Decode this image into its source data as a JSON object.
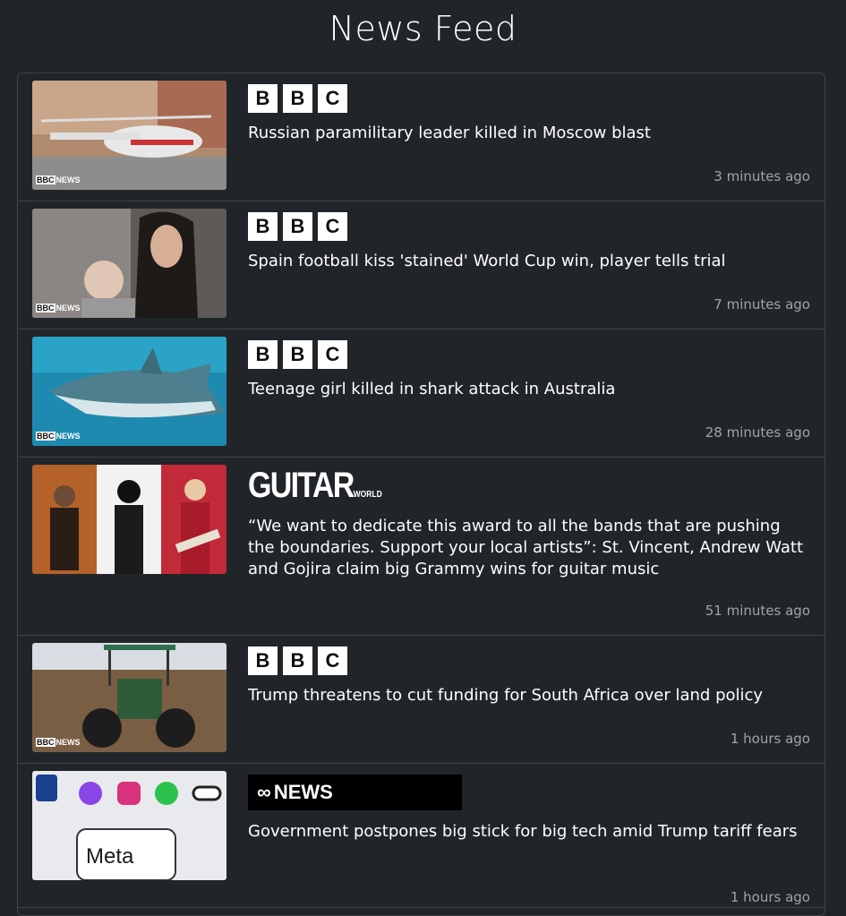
{
  "page": {
    "title": "News Feed"
  },
  "bbc_letters": [
    "B",
    "B",
    "C"
  ],
  "guitar_logo": {
    "main": "GUITAR",
    "sub": "WORLD"
  },
  "abc_logo": {
    "text": "NEWS"
  },
  "watermark": {
    "brand": "BBC",
    "label": "NEWS"
  },
  "items": [
    {
      "source": "bbc",
      "headline": "Russian paramilitary leader killed in Moscow blast",
      "time": "3 minutes ago",
      "image": "helicopter-photo"
    },
    {
      "source": "bbc",
      "headline": "Spain football kiss 'stained' World Cup win, player tells trial",
      "time": "7 minutes ago",
      "image": "footballer-photo"
    },
    {
      "source": "bbc",
      "headline": "Teenage girl killed in shark attack in Australia",
      "time": "28 minutes ago",
      "image": "shark-photo"
    },
    {
      "source": "guitarworld",
      "headline": "“We want to dedicate this award to all the bands that are pushing the boundaries. Support your local artists”: St. Vincent, Andrew Watt and Gojira claim big Grammy wins for guitar music",
      "time": "51 minutes ago",
      "image": "guitarists-photo"
    },
    {
      "source": "bbc",
      "headline": "Trump threatens to cut funding for South Africa over land policy",
      "time": "1 hours ago",
      "image": "tractor-photo"
    },
    {
      "source": "abc",
      "headline": "Government postpones big stick for big tech amid Trump tariff fears",
      "time": "1 hours ago",
      "image": "meta-apps-photo"
    }
  ],
  "meta_text": "Meta",
  "colors": {
    "background": "#212529",
    "border": "#3d4349",
    "muted": "#9ea4aa"
  }
}
